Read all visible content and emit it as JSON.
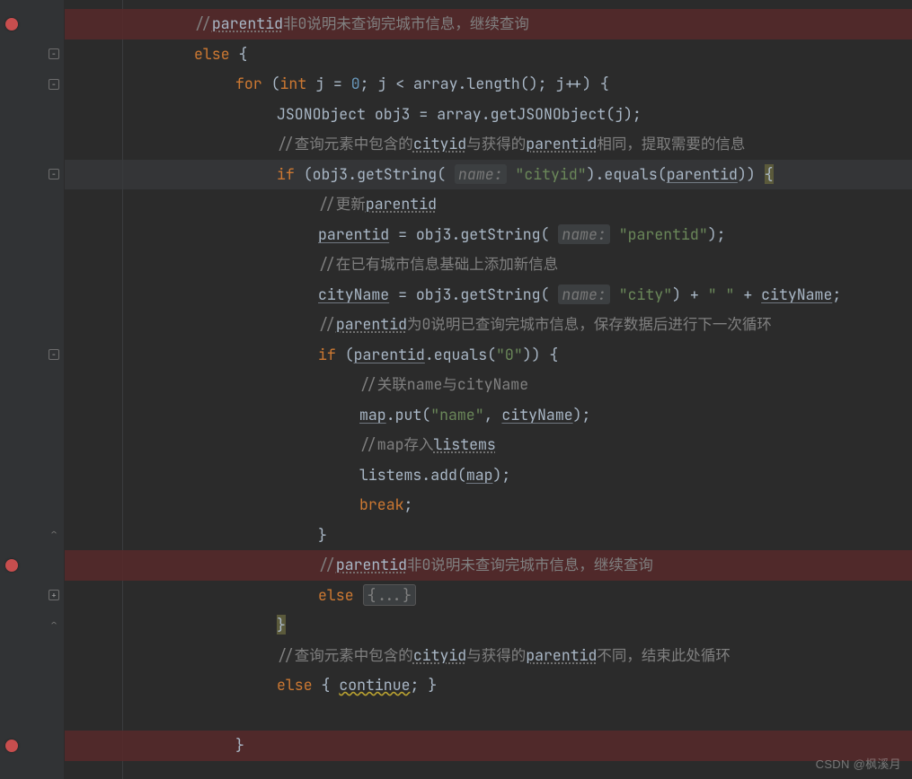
{
  "watermark": "CSDN @枫溪月",
  "lines": [
    {
      "t": "c",
      "indent": 3,
      "bp": true,
      "red": true,
      "tokens": [
        [
          "cm",
          "//"
        ],
        [
          "cmul",
          "parentid"
        ],
        [
          "cm",
          "非0说明未查询完城市信息，继续查询"
        ]
      ]
    },
    {
      "t": "c",
      "indent": 3,
      "fold": "-",
      "tokens": [
        [
          "kw",
          "else"
        ],
        [
          "p",
          " {"
        ]
      ]
    },
    {
      "t": "c",
      "indent": 4,
      "fold": "-",
      "tokens": [
        [
          "kw",
          "for"
        ],
        [
          "p",
          " ("
        ],
        [
          "kw",
          "int"
        ],
        [
          "p",
          " j = "
        ],
        [
          "num",
          "0"
        ],
        [
          "p",
          "; j < array.length(); j++) {"
        ]
      ]
    },
    {
      "t": "c",
      "indent": 5,
      "tokens": [
        [
          "p",
          "JSONObject obj3 = array.getJSONObject(j);"
        ]
      ]
    },
    {
      "t": "c",
      "indent": 5,
      "tokens": [
        [
          "cm",
          "//查询元素中包含的"
        ],
        [
          "cmul",
          "cityid"
        ],
        [
          "cm",
          "与获得的"
        ],
        [
          "cmul",
          "parentid"
        ],
        [
          "cm",
          "相同，提取需要的信息"
        ]
      ]
    },
    {
      "t": "c",
      "indent": 5,
      "fold": "-",
      "hl": true,
      "tokens": [
        [
          "kw",
          "if"
        ],
        [
          "p",
          " (obj3.getString( "
        ],
        [
          "hint",
          "name:"
        ],
        [
          "p",
          " "
        ],
        [
          "str",
          "\"cityid\""
        ],
        [
          "p",
          ").equals("
        ],
        [
          "ul",
          "parentid"
        ],
        [
          "p",
          ")) "
        ],
        [
          "carethl",
          "{"
        ]
      ]
    },
    {
      "t": "c",
      "indent": 6,
      "tokens": [
        [
          "cm",
          "//更新"
        ],
        [
          "cmul",
          "parentid"
        ]
      ]
    },
    {
      "t": "c",
      "indent": 6,
      "tokens": [
        [
          "ul",
          "parentid"
        ],
        [
          "p",
          " = obj3.getString( "
        ],
        [
          "hint",
          "name:"
        ],
        [
          "p",
          " "
        ],
        [
          "str",
          "\"parentid\""
        ],
        [
          "p",
          ");"
        ]
      ]
    },
    {
      "t": "c",
      "indent": 6,
      "tokens": [
        [
          "cm",
          "//在已有城市信息基础上添加新信息"
        ]
      ]
    },
    {
      "t": "c",
      "indent": 6,
      "tokens": [
        [
          "ul",
          "cityName"
        ],
        [
          "p",
          " = obj3.getString( "
        ],
        [
          "hint",
          "name:"
        ],
        [
          "p",
          " "
        ],
        [
          "str",
          "\"city\""
        ],
        [
          "p",
          ") + "
        ],
        [
          "str",
          "\" \""
        ],
        [
          "p",
          " + "
        ],
        [
          "ul",
          "cityName"
        ],
        [
          "p",
          ";"
        ]
      ]
    },
    {
      "t": "c",
      "indent": 6,
      "tokens": [
        [
          "cm",
          "//"
        ],
        [
          "cmul",
          "parentid"
        ],
        [
          "cm",
          "为0说明已查询完城市信息，保存数据后进行下一次循环"
        ]
      ]
    },
    {
      "t": "c",
      "indent": 6,
      "fold": "-",
      "tokens": [
        [
          "kw",
          "if"
        ],
        [
          "p",
          " ("
        ],
        [
          "ul",
          "parentid"
        ],
        [
          "p",
          ".equals("
        ],
        [
          "str",
          "\"0\""
        ],
        [
          "p",
          ")) {"
        ]
      ]
    },
    {
      "t": "c",
      "indent": 7,
      "tokens": [
        [
          "cm",
          "//关联name与cityName"
        ]
      ]
    },
    {
      "t": "c",
      "indent": 7,
      "tokens": [
        [
          "ul",
          "map"
        ],
        [
          "p",
          ".put("
        ],
        [
          "str",
          "\"name\""
        ],
        [
          "p",
          ", "
        ],
        [
          "ul",
          "cityName"
        ],
        [
          "p",
          ");"
        ]
      ]
    },
    {
      "t": "c",
      "indent": 7,
      "tokens": [
        [
          "cm",
          "//map存入"
        ],
        [
          "cmul",
          "listems"
        ]
      ]
    },
    {
      "t": "c",
      "indent": 7,
      "tokens": [
        [
          "p",
          "listems.add("
        ],
        [
          "ul",
          "map"
        ],
        [
          "p",
          ");"
        ]
      ]
    },
    {
      "t": "c",
      "indent": 7,
      "tokens": [
        [
          "kw",
          "break"
        ],
        [
          "p",
          ";"
        ]
      ]
    },
    {
      "t": "c",
      "indent": 6,
      "fold": "^",
      "tokens": [
        [
          "p",
          "}"
        ]
      ]
    },
    {
      "t": "c",
      "indent": 6,
      "bp": true,
      "red": true,
      "tokens": [
        [
          "cm",
          "//"
        ],
        [
          "cmul",
          "parentid"
        ],
        [
          "cm",
          "非0说明未查询完城市信息，继续查询"
        ]
      ]
    },
    {
      "t": "c",
      "indent": 6,
      "fold": "+",
      "tokens": [
        [
          "kw",
          "else"
        ],
        [
          "p",
          " "
        ],
        [
          "foldinline",
          "{...}"
        ]
      ]
    },
    {
      "t": "c",
      "indent": 5,
      "fold": "^",
      "tokens": [
        [
          "carethl",
          "}"
        ]
      ]
    },
    {
      "t": "c",
      "indent": 5,
      "tokens": [
        [
          "cm",
          "//查询元素中包含的"
        ],
        [
          "cmul",
          "cityid"
        ],
        [
          "cm",
          "与获得的"
        ],
        [
          "cmul",
          "parentid"
        ],
        [
          "cm",
          "不同，结束此处循环"
        ]
      ]
    },
    {
      "t": "c",
      "indent": 5,
      "tokens": [
        [
          "kw",
          "else"
        ],
        [
          "p",
          " { "
        ],
        [
          "warn",
          "continue"
        ],
        [
          "p",
          "; }"
        ]
      ]
    },
    {
      "t": "blank",
      "indent": 0
    },
    {
      "t": "c",
      "indent": 4,
      "bp": true,
      "red": true,
      "tokens": [
        [
          "p",
          "}"
        ]
      ]
    }
  ],
  "layout": {
    "lineHeight": 33.5,
    "indentUnit": 46,
    "baseIndent": 6,
    "startY": 10
  }
}
